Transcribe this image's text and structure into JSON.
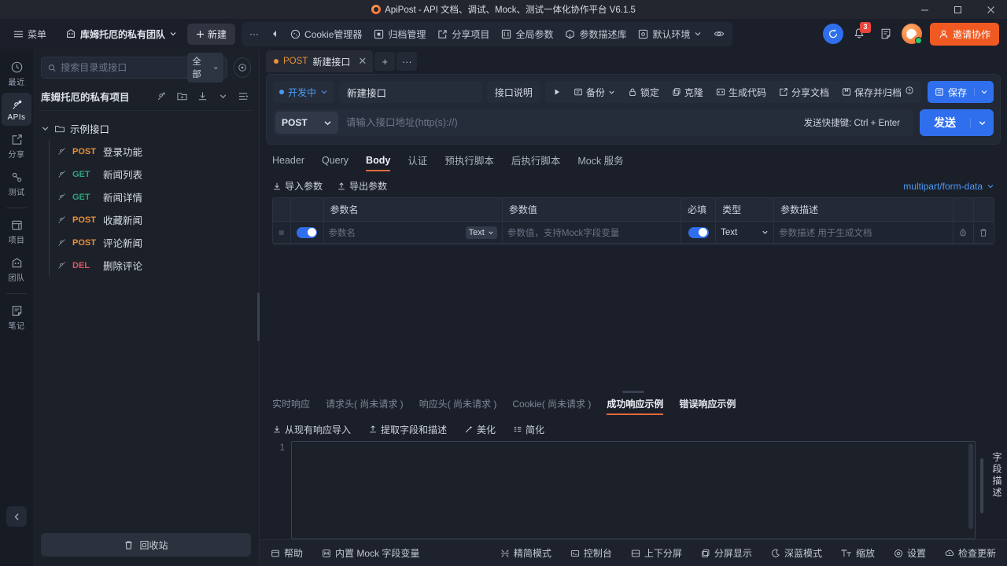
{
  "window": {
    "title": "ApiPost - API 文档、调试、Mock、测试一体化协作平台 V6.1.5",
    "minimize": "—",
    "maximize": "▢",
    "close": "✕"
  },
  "toolbar": {
    "menu": "菜单",
    "team": "库姆托厄的私有团队",
    "new": "新建",
    "more": "···",
    "back": "◀",
    "cookie_manager": "Cookie管理器",
    "archive_manager": "归档管理",
    "share_project": "分享项目",
    "global_params": "全局参数",
    "param_library": "参数描述库",
    "environment": "默认环境",
    "eye": "眼睛",
    "sync": "同步",
    "notifications_count": "3",
    "invite": "邀请协作"
  },
  "rail": {
    "items": [
      {
        "label": "最近",
        "icon": "clock-icon",
        "active": false
      },
      {
        "label": "APIs",
        "icon": "api-icon",
        "active": true
      },
      {
        "label": "分享",
        "icon": "share-icon",
        "active": false
      },
      {
        "label": "测试",
        "icon": "test-icon",
        "active": false
      },
      {
        "label": "项目",
        "icon": "project-icon",
        "active": false
      },
      {
        "label": "团队",
        "icon": "team-icon",
        "active": false
      },
      {
        "label": "笔记",
        "icon": "note-icon",
        "active": false
      }
    ],
    "collapse": "‹"
  },
  "sidebar": {
    "search_placeholder": "搜索目录或接口",
    "filter": "全部",
    "project_name": "库姆托厄的私有项目",
    "folder": "示例接口",
    "apis": [
      {
        "method": "POST",
        "name": "登录功能",
        "color": "#e99138"
      },
      {
        "method": "GET",
        "name": "新闻列表",
        "color": "#2fa37d"
      },
      {
        "method": "GET",
        "name": "新闻详情",
        "color": "#2fa37d"
      },
      {
        "method": "POST",
        "name": "收藏新闻",
        "color": "#e99138"
      },
      {
        "method": "POST",
        "name": "评论新闻",
        "color": "#e99138"
      },
      {
        "method": "DEL",
        "name": "删除评论",
        "color": "#e05563"
      }
    ],
    "recycle_bin": "回收站"
  },
  "tabstrip": {
    "tabs": [
      {
        "method": "POST",
        "title": "新建接口",
        "active": true
      }
    ],
    "add": "+",
    "more": "···"
  },
  "request": {
    "status": "开发中",
    "name_value": "新建接口",
    "name_placeholder": "新建接口",
    "doc_button": "接口说明",
    "run": "▶",
    "backup": "备份",
    "lock": "锁定",
    "clone": "克隆",
    "gen_code": "生成代码",
    "share_doc": "分享文档",
    "save_archive": "保存并归档",
    "help_mark": "?",
    "save": "保存",
    "method": "POST",
    "url_placeholder": "请输入接口地址(http(s)://)",
    "hotkey": "发送快捷键: Ctrl + Enter",
    "send": "发送"
  },
  "request_tabs": [
    {
      "label": "Header",
      "active": false
    },
    {
      "label": "Query",
      "active": false
    },
    {
      "label": "Body",
      "active": true
    },
    {
      "label": "认证",
      "active": false
    },
    {
      "label": "预执行脚本",
      "active": false
    },
    {
      "label": "后执行脚本",
      "active": false
    },
    {
      "label": "Mock 服务",
      "active": false
    }
  ],
  "params": {
    "import": "导入参数",
    "export": "导出参数",
    "content_type": "multipart/form-data",
    "columns": [
      "参数名",
      "参数值",
      "必填",
      "类型",
      "参数描述"
    ],
    "rows": [
      {
        "enabled": true,
        "name_placeholder": "参数名",
        "name_type": "Text",
        "value_placeholder": "参数值，支持Mock字段变量",
        "required": true,
        "type": "Text",
        "desc_placeholder": "参数描述 用于生成文档"
      }
    ]
  },
  "response": {
    "tabs": [
      {
        "label": "实时响应",
        "active": false
      },
      {
        "label": "请求头( 尚未请求 )",
        "active": false
      },
      {
        "label": "响应头( 尚未请求 )",
        "active": false
      },
      {
        "label": "Cookie( 尚未请求 )",
        "active": false
      },
      {
        "label": "成功响应示例",
        "active": true
      },
      {
        "label": "错误响应示例",
        "active": false
      }
    ],
    "tools": [
      {
        "label": "从现有响应导入",
        "icon": "import-icon"
      },
      {
        "label": "提取字段和描述",
        "icon": "extract-icon"
      },
      {
        "label": "美化",
        "icon": "beautify-icon"
      },
      {
        "label": "简化",
        "icon": "simplify-icon"
      }
    ],
    "line_number": "1",
    "code_value": "",
    "field_desc_label": "字段描述"
  },
  "statusbar": {
    "left": [
      {
        "label": "帮助",
        "icon": "help-icon"
      },
      {
        "label": "内置 Mock 字段变量",
        "icon": "mock-icon"
      }
    ],
    "right": [
      {
        "label": "精简模式",
        "icon": "compact-icon"
      },
      {
        "label": "控制台",
        "icon": "console-icon"
      },
      {
        "label": "上下分屏",
        "icon": "split-vertical-icon"
      },
      {
        "label": "分屏显示",
        "icon": "split-screen-icon"
      },
      {
        "label": "深蓝模式",
        "icon": "moon-icon"
      },
      {
        "label": "缩放",
        "icon": "zoom-icon"
      },
      {
        "label": "设置",
        "icon": "gear-icon"
      },
      {
        "label": "检查更新",
        "icon": "update-icon"
      }
    ]
  },
  "colors": {
    "accent_blue": "#2f6fed",
    "accent_orange": "#f05a22",
    "tab_underline": "#e06c3b",
    "method_post": "#e99138",
    "method_get": "#2fa37d",
    "method_del": "#e05563"
  }
}
